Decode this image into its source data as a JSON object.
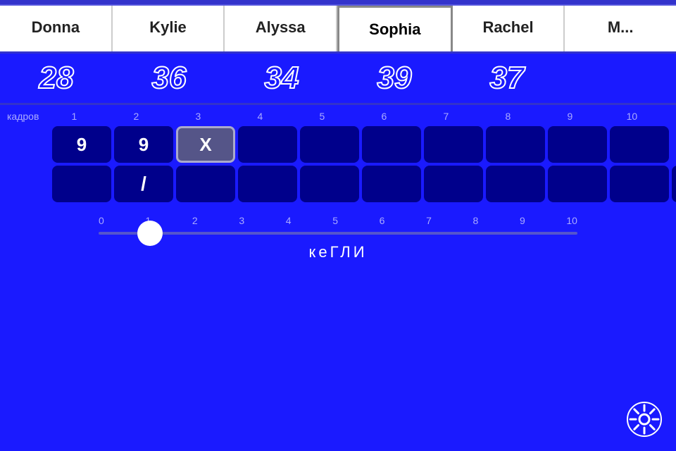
{
  "topbar": {},
  "players": [
    {
      "name": "Donna",
      "score": "28",
      "active": false
    },
    {
      "name": "Kylie",
      "score": "36",
      "active": false
    },
    {
      "name": "Alyssa",
      "score": "34",
      "active": false
    },
    {
      "name": "Sophia",
      "score": "39",
      "active": true
    },
    {
      "name": "Rachel",
      "score": "37",
      "active": false
    },
    {
      "name": "M...",
      "score": "?",
      "active": false
    }
  ],
  "frames_label": "кадров",
  "frame_numbers": [
    "1",
    "2",
    "3",
    "4",
    "5",
    "6",
    "7",
    "8",
    "9",
    "10"
  ],
  "frames": [
    {
      "row1": "9",
      "row2": ""
    },
    {
      "row1": "9",
      "row2": "/"
    },
    {
      "row1": "X",
      "row2": "",
      "active": true
    },
    {
      "row1": "",
      "row2": ""
    },
    {
      "row1": "",
      "row2": ""
    },
    {
      "row1": "",
      "row2": ""
    },
    {
      "row1": "",
      "row2": ""
    },
    {
      "row1": "",
      "row2": ""
    },
    {
      "row1": "",
      "row2": ""
    },
    {
      "row1": "",
      "row2": "",
      "extra": ""
    }
  ],
  "pins_numbers": [
    "0",
    "1",
    "2",
    "3",
    "4",
    "5",
    "6",
    "7",
    "8",
    "9",
    "10"
  ],
  "pins_label": "кеГЛИ",
  "slider_value": 1,
  "settings_label": "settings-gear"
}
